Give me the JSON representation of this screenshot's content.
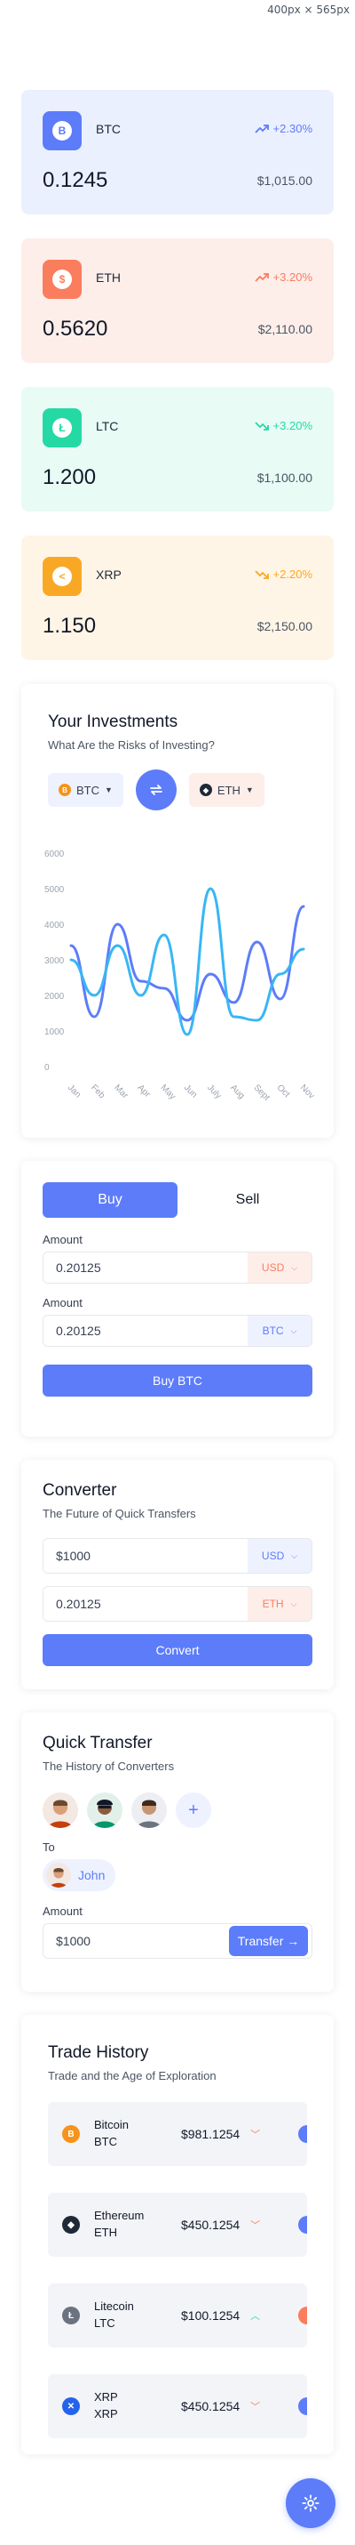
{
  "viewport_label": "400px × 565px",
  "coins": [
    {
      "symbol": "BTC",
      "change": "+2.30%",
      "trend": "up",
      "amount": "0.1245",
      "usd": "$1,015.00",
      "glyph": "B",
      "bg": "#ebf0ff",
      "icon_bg": "#5c7cfa",
      "accent": "#5c7cfa"
    },
    {
      "symbol": "ETH",
      "change": "+3.20%",
      "trend": "up",
      "amount": "0.5620",
      "usd": "$2,110.00",
      "glyph": "$",
      "bg": "#fdeeea",
      "icon_bg": "#fa7d5e",
      "accent": "#fa7d5e"
    },
    {
      "symbol": "LTC",
      "change": "+3.20%",
      "trend": "down",
      "amount": "1.200",
      "usd": "$1,100.00",
      "glyph": "Ł",
      "bg": "#e8fbf5",
      "icon_bg": "#25d9a5",
      "accent": "#25d9a5"
    },
    {
      "symbol": "XRP",
      "change": "+2.20%",
      "trend": "down",
      "amount": "1.150",
      "usd": "$2,150.00",
      "glyph": "<",
      "bg": "#fff5e6",
      "icon_bg": "#f9a825",
      "accent": "#f9a825"
    }
  ],
  "investments": {
    "title": "Your Investments",
    "subtitle": "What Are the Risks of Investing?",
    "from_coin": "BTC",
    "to_coin": "ETH"
  },
  "chart_data": {
    "type": "line",
    "categories": [
      "Jan",
      "Feb",
      "Mar",
      "Apr",
      "May",
      "Jun",
      "July",
      "Aug",
      "Sept",
      "Oct",
      "Nov"
    ],
    "yticks": [
      "6000",
      "5000",
      "4000",
      "3000",
      "2000",
      "1000",
      "0"
    ],
    "ylim": [
      0,
      6000
    ],
    "series": [
      {
        "color": "#5c7cfa",
        "values": [
          3400,
          1400,
          4000,
          2400,
          2200,
          1300,
          2600,
          1800,
          3500,
          1900,
          4500
        ]
      },
      {
        "color": "#38b6f5",
        "values": [
          3000,
          2000,
          3400,
          2000,
          3700,
          900,
          5000,
          1400,
          1300,
          2600,
          3300
        ]
      }
    ],
    "grid": false,
    "legend": "none"
  },
  "trade": {
    "buy_label": "Buy",
    "sell_label": "Sell",
    "amount_label_1": "Amount",
    "amount_value_1": "0.20125",
    "currency_1": "USD",
    "amount_label_2": "Amount",
    "amount_value_2": "0.20125",
    "currency_2": "BTC",
    "submit_label": "Buy BTC"
  },
  "converter": {
    "title": "Converter",
    "subtitle": "The Future of Quick Transfers",
    "value_1": "$1000",
    "currency_1": "USD",
    "value_2": "0.20125",
    "currency_2": "ETH",
    "submit_label": "Convert"
  },
  "quick_transfer": {
    "title": "Quick Transfer",
    "subtitle": "The History of Converters",
    "add_symbol": "+",
    "to_label": "To",
    "recipient": "John",
    "amount_label": "Amount",
    "amount_value": "$1000",
    "submit_label": "Transfer →"
  },
  "trade_history": {
    "title": "Trade History",
    "subtitle": "Trade and the Age of Exploration",
    "rows": [
      {
        "name": "Bitcoin",
        "symbol": "BTC",
        "price": "$981.1254",
        "trend": "down",
        "icon_bg": "#f7931a",
        "glyph": "B",
        "side": "#5c7cfa"
      },
      {
        "name": "Ethereum",
        "symbol": "ETH",
        "price": "$450.1254",
        "trend": "down",
        "icon_bg": "#1f2937",
        "glyph": "◆",
        "side": "#5c7cfa"
      },
      {
        "name": "Litecoin",
        "symbol": "LTC",
        "price": "$100.1254",
        "trend": "up",
        "icon_bg": "#6b7280",
        "glyph": "Ł",
        "side": "#fa7d5e"
      },
      {
        "name": "XRP",
        "symbol": "XRP",
        "price": "$450.1254",
        "trend": "down",
        "icon_bg": "#2563eb",
        "glyph": "✕",
        "side": "#5c7cfa"
      }
    ]
  },
  "colors": {
    "primary": "#5c7cfa",
    "up": "#5c7cfa",
    "down": "#fa7d5e",
    "positive": "#25d9a5"
  }
}
